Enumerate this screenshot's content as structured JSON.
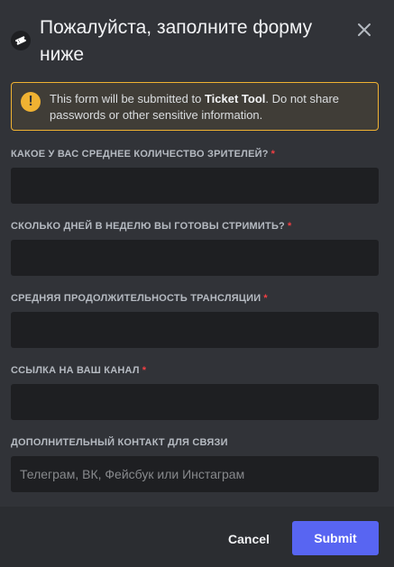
{
  "header": {
    "title": "Пожалуйста, заполните форму ниже",
    "app_icon": "ticket-icon",
    "close_icon": "close-icon"
  },
  "notice": {
    "icon": "exclamation-icon",
    "text_prefix": "This form will be submitted to ",
    "app_name": "Ticket Tool",
    "text_suffix": ". Do not share passwords or other sensitive information.",
    "warn_glyph": "!",
    "border_color": "#f0b232"
  },
  "fields": [
    {
      "label": "КАКОЕ У ВАС СРЕДНЕЕ КОЛИЧЕСТВО ЗРИТЕЛЕЙ?",
      "required_marker": "*",
      "value": "",
      "placeholder": ""
    },
    {
      "label": "СКОЛЬКО ДНЕЙ В НЕДЕЛЮ ВЫ ГОТОВЫ СТРИМИТЬ?",
      "required_marker": "*",
      "value": "",
      "placeholder": ""
    },
    {
      "label": "СРЕДНЯЯ ПРОДОЛЖИТЕЛЬНОСТЬ ТРАНСЛЯЦИИ",
      "required_marker": "*",
      "value": "",
      "placeholder": ""
    },
    {
      "label": "ССЫЛКА НА ВАШ КАНАЛ",
      "required_marker": "*",
      "value": "",
      "placeholder": ""
    },
    {
      "label": "ДОПОЛНИТЕЛЬНЫЙ КОНТАКТ ДЛЯ СВЯЗИ",
      "value": "",
      "placeholder": "Телеграм, ВК, Фейсбук или Инстаграм"
    }
  ],
  "footer": {
    "cancel_label": "Cancel",
    "submit_label": "Submit"
  },
  "colors": {
    "background": "#313338",
    "footer": "#2b2d31",
    "input": "#1e1f22",
    "accent": "#5865f2",
    "required": "#f23f43",
    "warning": "#f0b232"
  }
}
